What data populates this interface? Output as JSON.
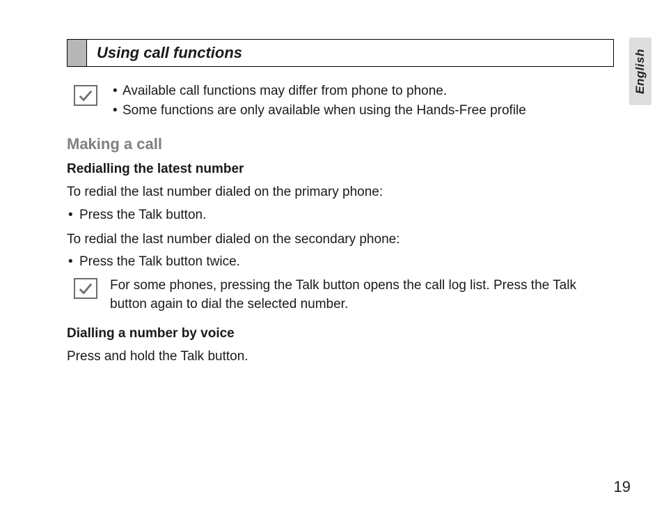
{
  "language_tab": "English",
  "section_title": "Using call functions",
  "top_notes": [
    "Available call functions may differ from phone to phone.",
    "Some functions are only available when using the Hands-Free profile"
  ],
  "h2_making_call": "Making a call",
  "h3_redial": "Redialling the latest number",
  "redial_primary_intro": "To redial the  last number dialed on the primary phone:",
  "redial_primary_step": "Press the Talk button.",
  "redial_secondary_intro": "To redial the last number dialed on the secondary phone:",
  "redial_secondary_step": "Press the Talk button twice.",
  "mid_note": "For some phones, pressing the Talk button opens the call log list. Press the Talk button again to dial the selected number.",
  "h3_voice": "Dialling a number by voice",
  "voice_text": "Press and hold the Talk button.",
  "page_number": "19"
}
